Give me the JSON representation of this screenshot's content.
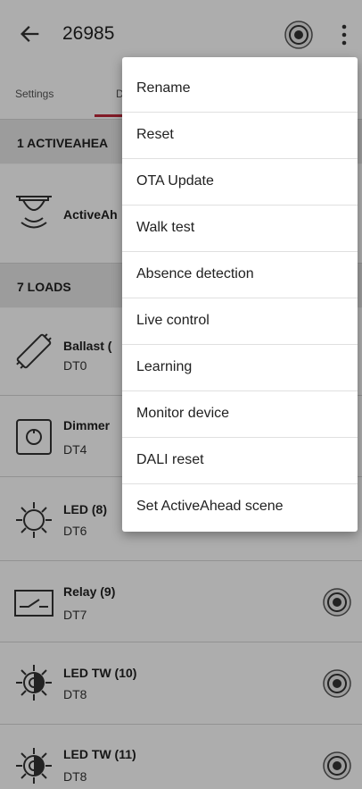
{
  "header": {
    "title": "26985",
    "back_icon": "arrow-left-icon",
    "target_icon": "target-icon",
    "menu_icon": "more-vert-icon"
  },
  "tabs": [
    {
      "label": "Settings"
    },
    {
      "label": "D"
    }
  ],
  "sections": {
    "activeahead": "1 ACTIVEAHEA",
    "loads": "7 LOADS"
  },
  "sensor": {
    "name": "ActiveAh"
  },
  "loads": [
    {
      "name": "Ballast (",
      "type": "DT0",
      "icon": "tube-lamp-icon"
    },
    {
      "name": "Dimmer",
      "type": "DT4",
      "icon": "dimmer-icon"
    },
    {
      "name": "LED (8)",
      "type": "DT6",
      "icon": "led-bulb-icon"
    },
    {
      "name": "Relay (9)",
      "type": "DT7",
      "icon": "relay-switch-icon"
    },
    {
      "name": "LED TW (10)",
      "type": "DT8",
      "icon": "led-tunable-white-icon"
    },
    {
      "name": "LED TW (11)",
      "type": "DT8",
      "icon": "led-tunable-white-icon"
    }
  ],
  "menu": {
    "items": [
      {
        "label": "Rename"
      },
      {
        "label": "Reset"
      },
      {
        "label": "OTA Update"
      },
      {
        "label": "Walk test"
      },
      {
        "label": "Absence detection"
      },
      {
        "label": "Live control"
      },
      {
        "label": "Learning"
      },
      {
        "label": "Monitor device"
      },
      {
        "label": "DALI reset"
      },
      {
        "label": "Set ActiveAhead scene"
      }
    ]
  },
  "colors": {
    "accent": "#c0283a",
    "scrim": "rgba(0,0,0,0.32)"
  }
}
